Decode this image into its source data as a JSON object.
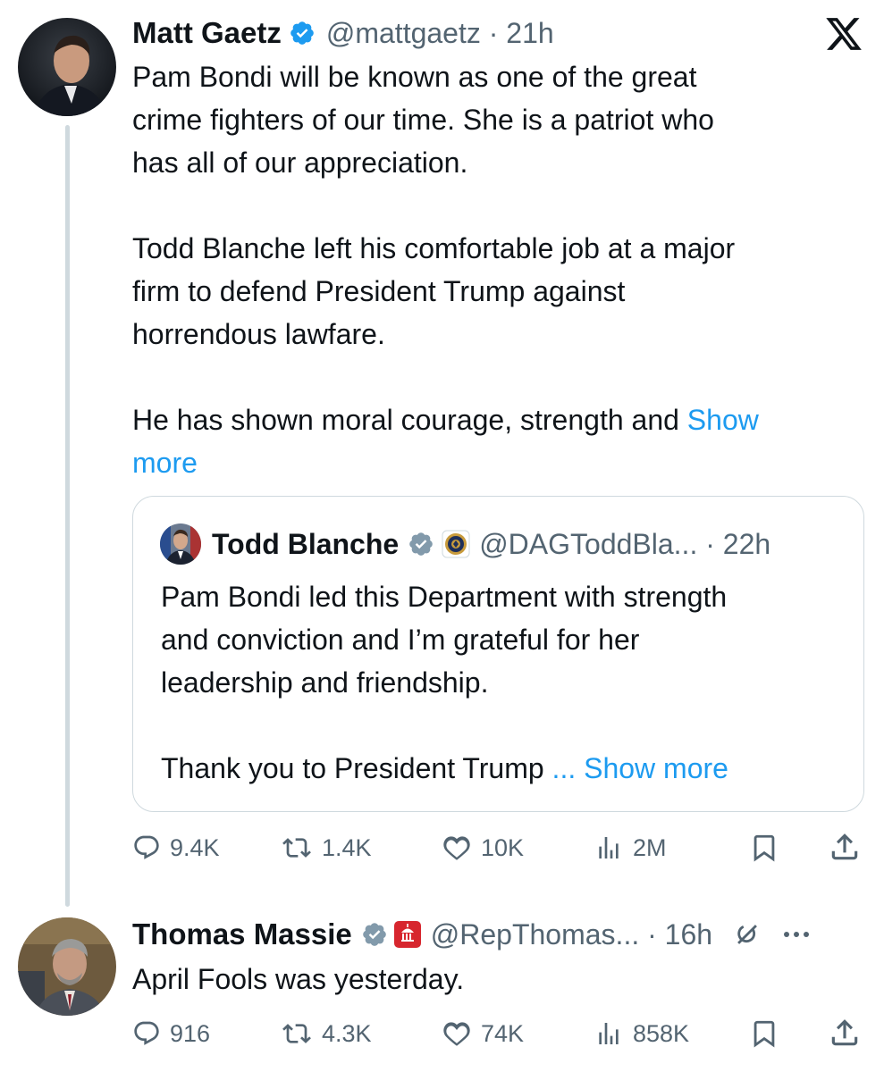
{
  "tweet": {
    "author_name": "Matt Gaetz",
    "handle_line": "@mattgaetz · 21h",
    "platform": "X",
    "body": "Pam Bondi will be known as one of the great\ncrime fighters of our time. She is a patriot who\nhas all of our appreciation.\n\nTodd Blanche left his comfortable job at a major\nfirm to defend President Trump against\nhorrendous lawfare.\n\nHe has shown moral courage, strength and ",
    "show_more_1": "Show",
    "show_more_2": "more",
    "quoted": {
      "author_name": "Todd Blanche",
      "handle_line": "@DAGToddBla... · 22h",
      "body": "Pam Bondi led this Department with strength\nand conviction and I’m grateful for her\nleadership and friendship.\n\nThank you to President Trump ",
      "show_more": "... Show more"
    },
    "stats": {
      "replies": "9.4K",
      "reposts": "1.4K",
      "likes": "10K",
      "views": "2M"
    }
  },
  "reply": {
    "author_name": "Thomas Massie",
    "handle_line": "@RepThomas... · 16h",
    "body": "April Fools was yesterday.",
    "stats": {
      "replies": "916",
      "reposts": "4.3K",
      "likes": "74K",
      "views": "858K"
    }
  },
  "colors": {
    "verified_blue": "#1d9bf0",
    "verified_gray": "#829aab",
    "link": "#1d9bf0",
    "muted": "#536471"
  },
  "icons": [
    "x-logo-icon",
    "verified-badge-icon",
    "gov-seal-icon",
    "reply-icon",
    "repost-icon",
    "like-icon",
    "views-icon",
    "bookmark-icon",
    "share-icon",
    "grok-icon",
    "more-icon"
  ]
}
